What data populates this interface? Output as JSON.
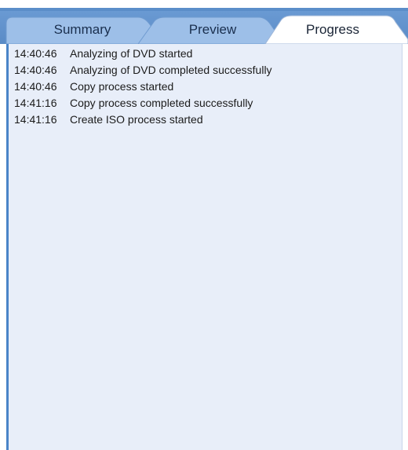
{
  "tabs": [
    {
      "label": "Summary",
      "selected": false
    },
    {
      "label": "Preview",
      "selected": false
    },
    {
      "label": "Progress",
      "selected": true
    }
  ],
  "log": [
    {
      "time": "14:40:46",
      "message": "Analyzing of DVD started"
    },
    {
      "time": "14:40:46",
      "message": "Analyzing of DVD completed successfully"
    },
    {
      "time": "14:40:46",
      "message": "Copy process started"
    },
    {
      "time": "14:41:16",
      "message": "Copy process completed successfully"
    },
    {
      "time": "14:41:16",
      "message": "Create ISO process started"
    }
  ],
  "colors": {
    "tab_active": "#ffffff",
    "tab_inactive": "#9dbfe8",
    "content_bg": "#e8eef9",
    "accent": "#4a84c8"
  }
}
